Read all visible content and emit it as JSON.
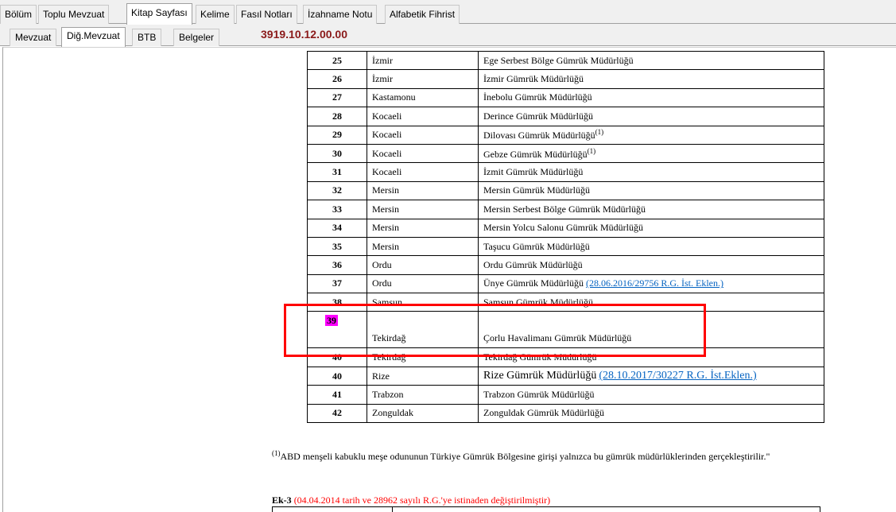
{
  "tabs_main": [
    "Bölüm",
    "Toplu Mevzuat",
    "Kitap Sayfası",
    "Kelime",
    "Fasıl Notları",
    "İzahname Notu",
    "Alfabetik Fihrist"
  ],
  "tabs_sub": [
    "Mevzuat",
    "Diğ.Mevzuat",
    "BTB",
    "Belgeler"
  ],
  "code": "3919.10.12.00.00",
  "rows": [
    {
      "no": "25",
      "city": "İzmir",
      "office": "Ege Serbest Bölge Gümrük Müdürlüğü"
    },
    {
      "no": "26",
      "city": "İzmir",
      "office": "İzmir Gümrük Müdürlüğü"
    },
    {
      "no": "27",
      "city": "Kastamonu",
      "office": "İnebolu Gümrük Müdürlüğü"
    },
    {
      "no": "28",
      "city": "Kocaeli",
      "office": "Derince Gümrük Müdürlüğü"
    },
    {
      "no": "29",
      "city": "Kocaeli",
      "office": "Dilovası Gümrük Müdürlüğü",
      "sup": "(1)"
    },
    {
      "no": "30",
      "city": "Kocaeli",
      "office": "Gebze Gümrük Müdürlüğü",
      "sup": "(1)"
    },
    {
      "no": "31",
      "city": "Kocaeli",
      "office": "İzmit Gümrük Müdürlüğü"
    },
    {
      "no": "32",
      "city": "Mersin",
      "office": "Mersin Gümrük Müdürlüğü"
    },
    {
      "no": "33",
      "city": "Mersin",
      "office": "Mersin Serbest Bölge Gümrük Müdürlüğü"
    },
    {
      "no": "34",
      "city": "Mersin",
      "office": "Mersin Yolcu Salonu Gümrük Müdürlüğü"
    },
    {
      "no": "35",
      "city": "Mersin",
      "office": "Taşucu Gümrük Müdürlüğü"
    },
    {
      "no": "36",
      "city": "Ordu",
      "office": "Ordu Gümrük Müdürlüğü"
    },
    {
      "no": "37",
      "city": "Ordu",
      "office": "Ünye Gümrük Müdürlüğü",
      "link": "(28.06.2016/29756 R.G. İst. Eklen.)"
    },
    {
      "no": "38",
      "city": "Samsun",
      "office": "Samsun Gümrük Müdürlüğü"
    },
    {
      "no": "39",
      "city": "Tekirdağ",
      "office": "Çorlu Havalimanı Gümrük Müdürlüğü",
      "highlight": true,
      "tall": true
    },
    {
      "no": "40",
      "city": "Tekirdağ",
      "office": "Tekirdağ Gümrük Müdürlüğü"
    },
    {
      "no": "40",
      "city": "Rize",
      "office": "Rize Gümrük Müdürlüğü",
      "link": "(28.10.2017/30227 R.G. İst.Eklen.)",
      "big": true
    },
    {
      "no": "41",
      "city": "Trabzon",
      "office": "Trabzon Gümrük Müdürlüğü"
    },
    {
      "no": "42",
      "city": "Zonguldak",
      "office": "Zonguldak Gümrük Müdürlüğü"
    }
  ],
  "footnote": {
    "mark": "(1)",
    "text": "ABD menşeli kabuklu meşe odununun Türkiye Gümrük Bölgesine girişi yalnızca bu gümrük müdürlüklerinden gerçekleştirilir.\""
  },
  "ek3": {
    "label": "Ek-3",
    "note": "(04.04.2014 tarih ve 28962 sayılı R.G.'ye istinaden değiştirilmiştir)"
  },
  "colors": {
    "code": "#8b1a1a",
    "highlight": "#ff00ff",
    "annotation_box": "#ff0000",
    "link": "#0563c1"
  }
}
